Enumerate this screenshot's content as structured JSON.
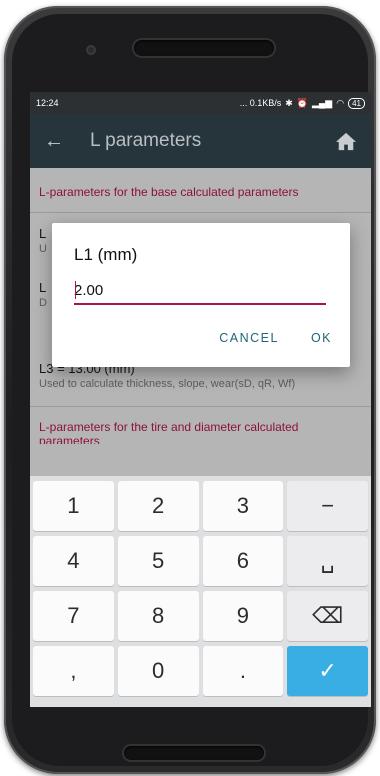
{
  "status_bar": {
    "time": "12:24",
    "network_speed": "... 0.1KB/s",
    "battery": "41"
  },
  "app_bar": {
    "title": "L parameters",
    "back_icon": "arrow-back-icon",
    "home_icon": "home-icon"
  },
  "sections": {
    "base_header": "L-parameters for the base calculated parameters",
    "tire_header": "L-parameters for the tire and diameter calculated parameters"
  },
  "params": [
    {
      "name": "L",
      "desc": "U"
    },
    {
      "name": "L",
      "desc": "D"
    },
    {
      "name": "L3 = 13.00 (mm)",
      "desc": "Used to calculate thickness, slope, wear(sD, qR, Wf)"
    }
  ],
  "dialog": {
    "title": "L1 (mm)",
    "value": "2.00",
    "cancel_label": "CANCEL",
    "ok_label": "OK"
  },
  "keyboard": {
    "keys": [
      "1",
      "2",
      "3",
      "−",
      "4",
      "5",
      "6",
      "␣",
      "7",
      "8",
      "9",
      "⌫",
      ",",
      "0",
      ".",
      "✓"
    ]
  },
  "colors": {
    "accent": "#a8164d",
    "app_bar": "#26353c",
    "section_header": "#8c1238",
    "dialog_button": "#1f6676",
    "keyboard_done": "#38aee5"
  }
}
